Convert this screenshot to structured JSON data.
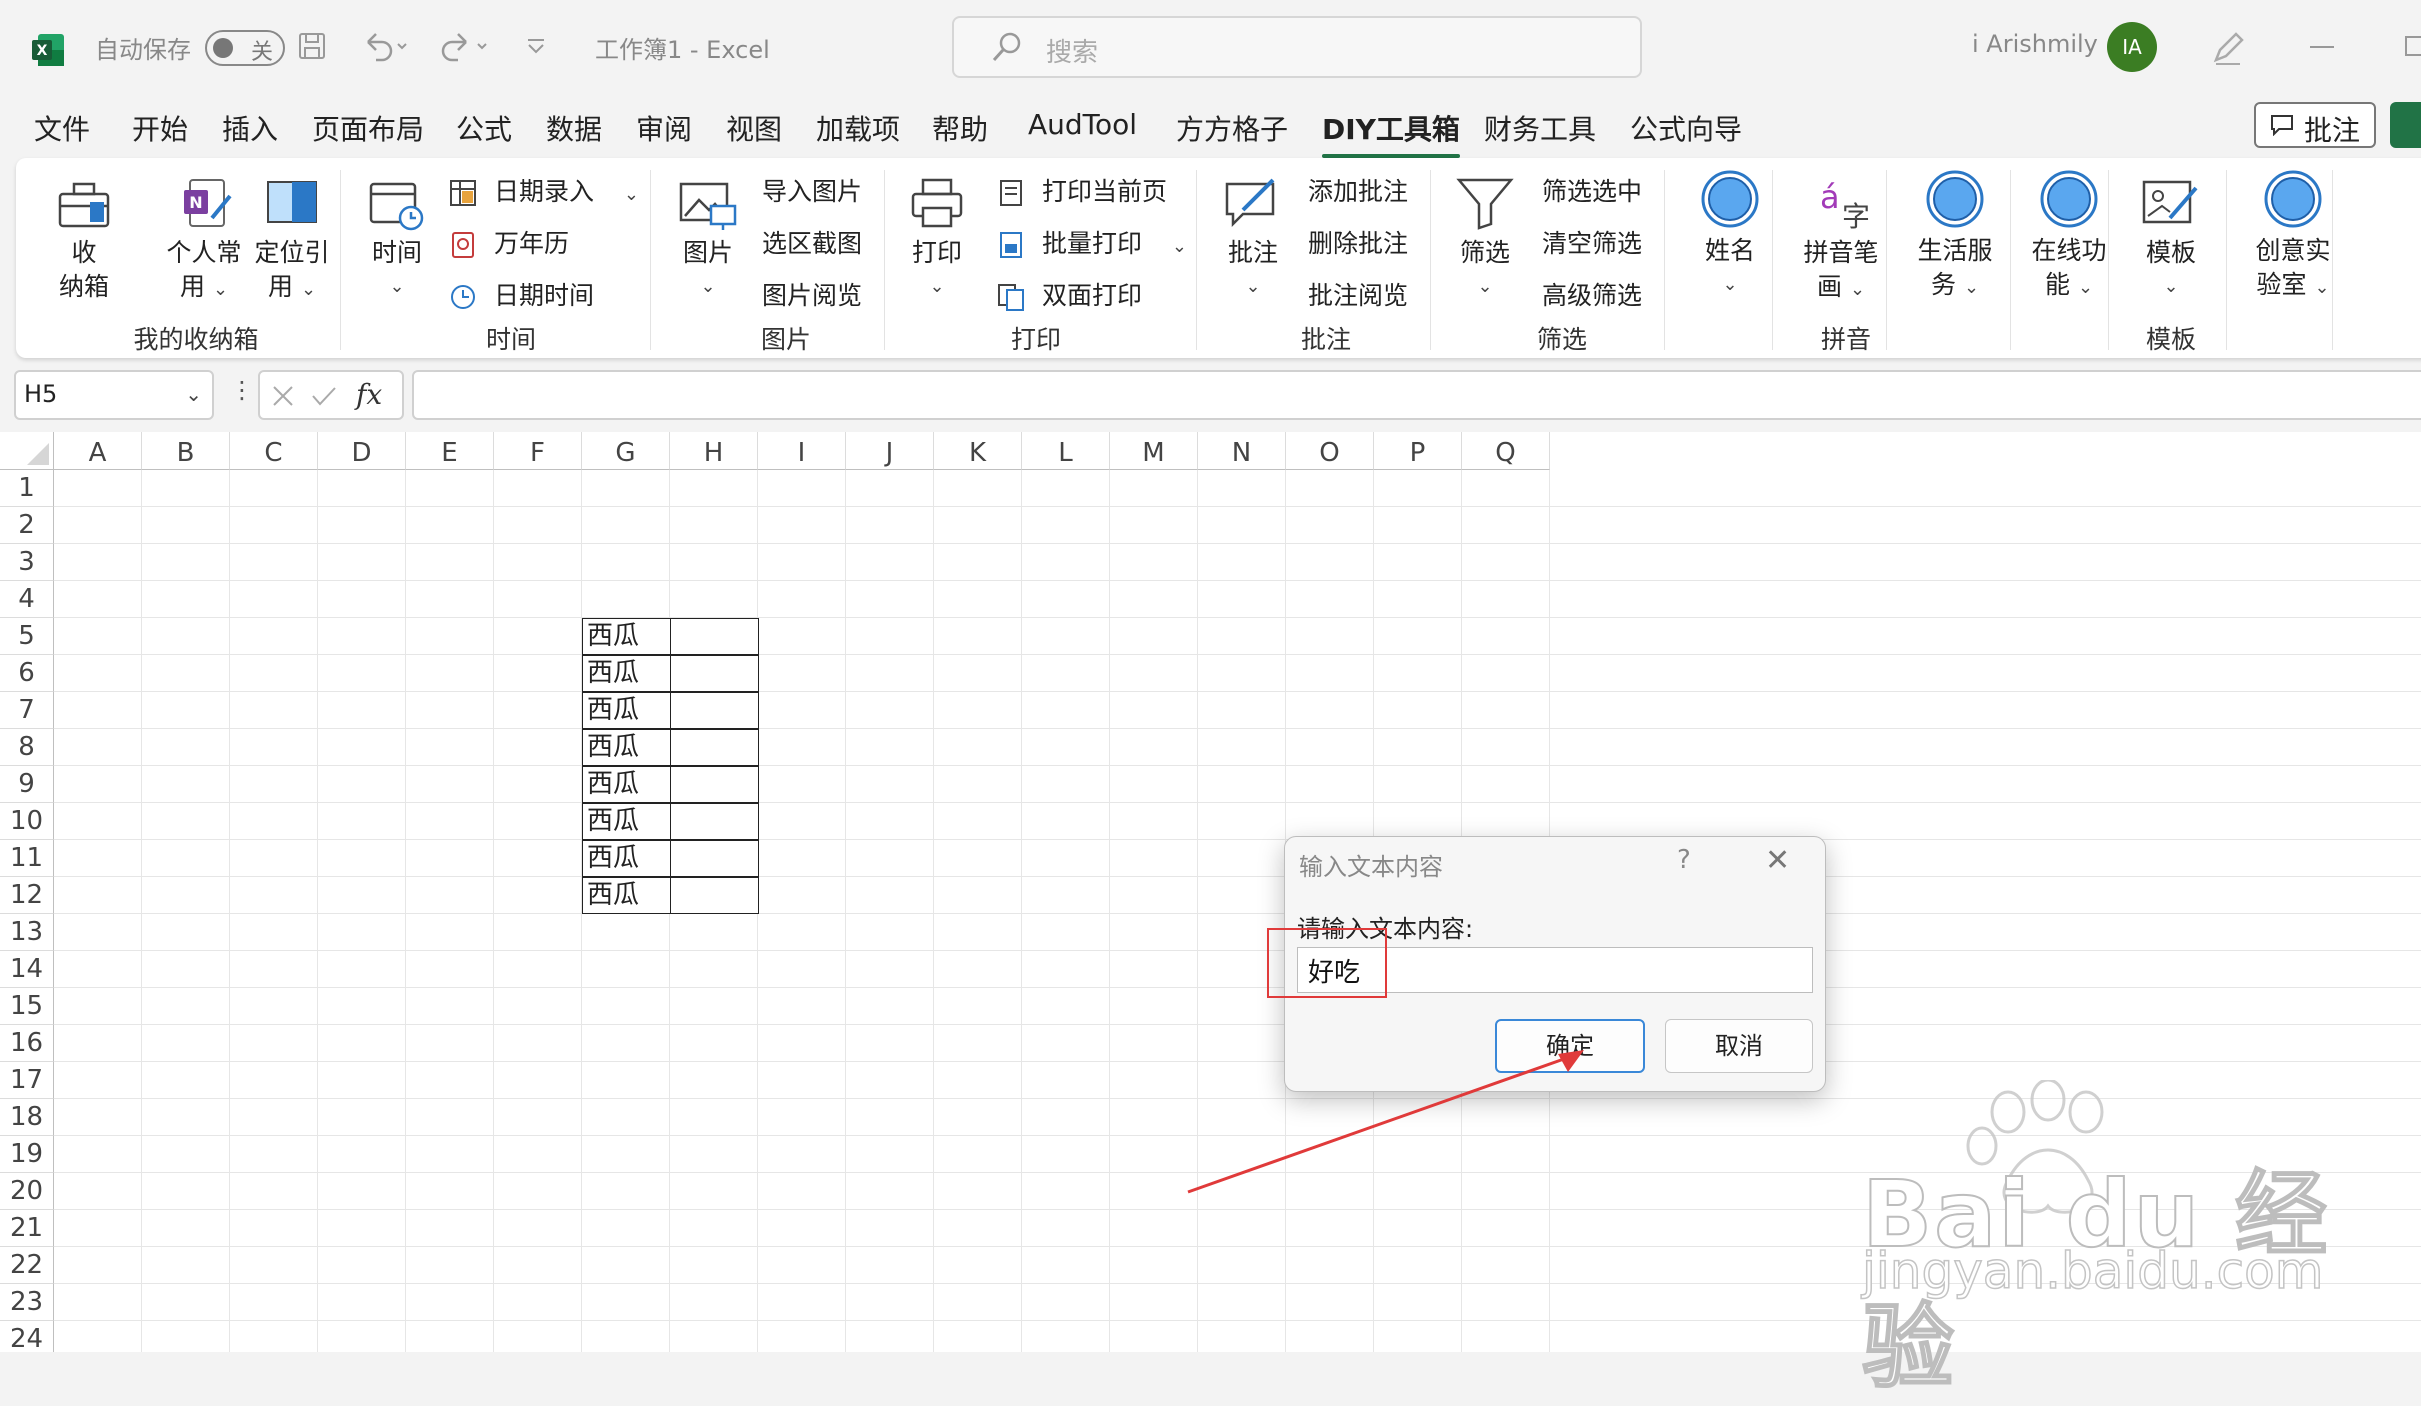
{
  "titlebar": {
    "autosave_label": "自动保存",
    "autosave_state": "关",
    "doc_title": "工作簿1  -  Excel",
    "search_placeholder": "搜索",
    "username": "i Arishmily",
    "avatar_initials": "IA"
  },
  "menu": {
    "tabs": [
      "文件",
      "开始",
      "插入",
      "页面布局",
      "公式",
      "数据",
      "审阅",
      "视图",
      "加载项",
      "帮助",
      "AudTool",
      "方方格子",
      "DIY工具箱",
      "财务工具",
      "公式向导"
    ],
    "active_tab": "DIY工具箱",
    "comment_button": "批注"
  },
  "ribbon": {
    "box": {
      "label_line1": "收",
      "label_line2": "纳箱"
    },
    "personal": {
      "label_line1": "个人常",
      "label_line2": "用"
    },
    "locate": {
      "label_line1": "定位引",
      "label_line2": "用"
    },
    "time": {
      "label": "时间"
    },
    "date_entry": "日期录入",
    "calendar": "万年历",
    "datetime": "日期时间",
    "picture": {
      "label": "图片"
    },
    "import_picture": "导入图片",
    "region_capture": "选区截图",
    "picture_browse": "图片阅览",
    "print": {
      "label": "打印"
    },
    "print_current": "打印当前页",
    "batch_print": "批量打印",
    "duplex_print": "双面打印",
    "comment": {
      "label": "批注"
    },
    "add_comment": "添加批注",
    "delete_comment": "删除批注",
    "comment_browse": "批注阅览",
    "filter": {
      "label": "筛选"
    },
    "filter_selected": "筛选选中",
    "clear_filter": "清空筛选",
    "advanced_filter": "高级筛选",
    "name": {
      "label": "姓名"
    },
    "pinyin": {
      "label_line1": "拼音笔",
      "label_line2": "画"
    },
    "life": {
      "label_line1": "生活服",
      "label_line2": "务"
    },
    "online": {
      "label_line1": "在线功",
      "label_line2": "能"
    },
    "template": {
      "label": "模板"
    },
    "lab": {
      "label_line1": "创意实",
      "label_line2": "验室"
    },
    "groups": [
      "我的收纳箱",
      "时间",
      "图片",
      "打印",
      "批注",
      "筛选",
      "拼音",
      "模板"
    ]
  },
  "formula_bar": {
    "name_box": "H5",
    "fx": "fx",
    "value": ""
  },
  "sheet": {
    "columns": [
      "A",
      "B",
      "C",
      "D",
      "E",
      "F",
      "G",
      "H",
      "I",
      "J",
      "K",
      "L",
      "M",
      "N",
      "O",
      "P",
      "Q"
    ],
    "rows": [
      "1",
      "2",
      "3",
      "4",
      "5",
      "6",
      "7",
      "8",
      "9",
      "10",
      "11",
      "12",
      "13",
      "14",
      "15",
      "16",
      "17",
      "18",
      "19",
      "20",
      "21",
      "22",
      "23",
      "24"
    ],
    "table": {
      "g_values": [
        "西瓜",
        "西瓜",
        "西瓜",
        "西瓜",
        "西瓜",
        "西瓜",
        "西瓜",
        "西瓜"
      ],
      "h_values": [
        "",
        "",
        "",
        "",
        "",
        "",
        "",
        ""
      ]
    }
  },
  "dialog": {
    "title": "输入文本内容",
    "help": "?",
    "close": "✕",
    "prompt": "请输入文本内容:",
    "input_value": "好吃",
    "ok": "确定",
    "cancel": "取消"
  },
  "watermark": {
    "brand": "Bai du 经验",
    "url": "jingyan.baidu.com"
  },
  "colors": {
    "accent": "#217346",
    "highlight_red": "#e03a3a",
    "dialog_ok_border": "#3a88d8"
  }
}
